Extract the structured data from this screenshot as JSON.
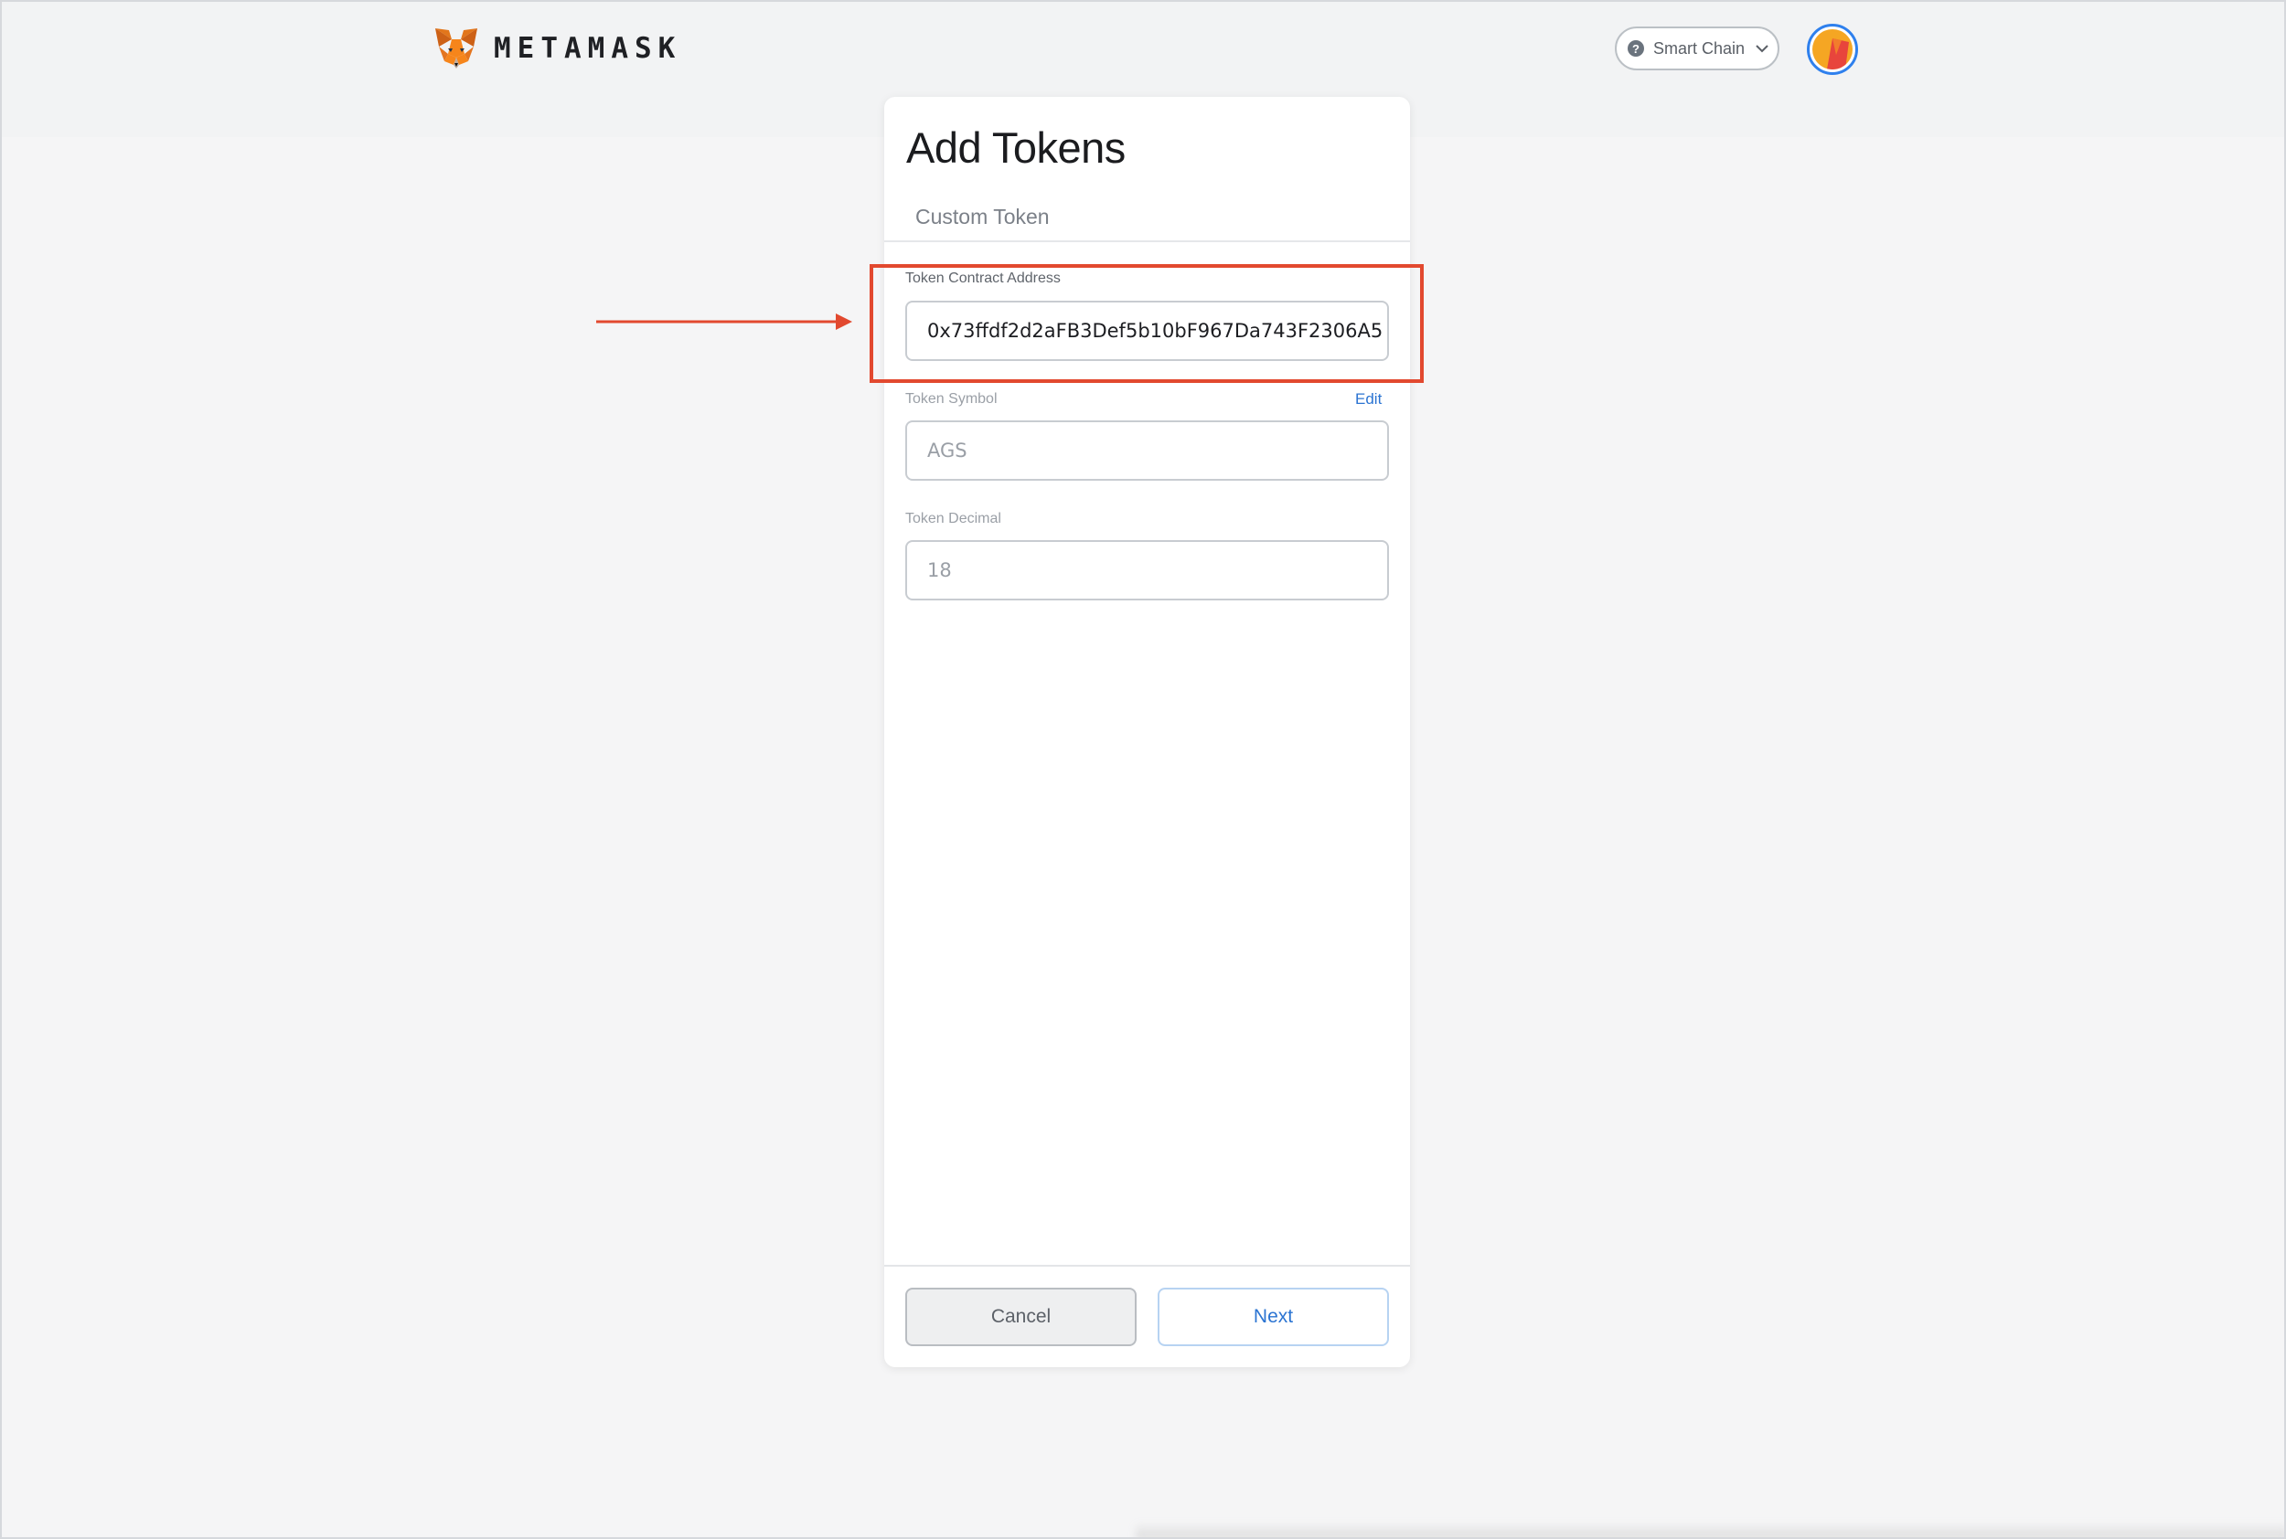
{
  "header": {
    "brand": "METAMASK",
    "network_label": "Smart Chain",
    "network_icon": "question-circle-icon",
    "avatar_icon": "account-avatar"
  },
  "dialog": {
    "title": "Add Tokens",
    "tab_label": "Custom Token",
    "fields": {
      "contract_address": {
        "label": "Token Contract Address",
        "value": "0x73ffdf2d2aFB3Def5b10bF967Da743F2306A5"
      },
      "symbol": {
        "label": "Token Symbol",
        "edit_label": "Edit",
        "value": "AGS"
      },
      "decimal": {
        "label": "Token Decimal",
        "value": "18"
      }
    },
    "buttons": {
      "cancel": "Cancel",
      "next": "Next"
    }
  },
  "annotation": {
    "color": "#e2492f"
  },
  "colors": {
    "accent_blue": "#2b74d2",
    "fox_orange": "#e2761b"
  }
}
